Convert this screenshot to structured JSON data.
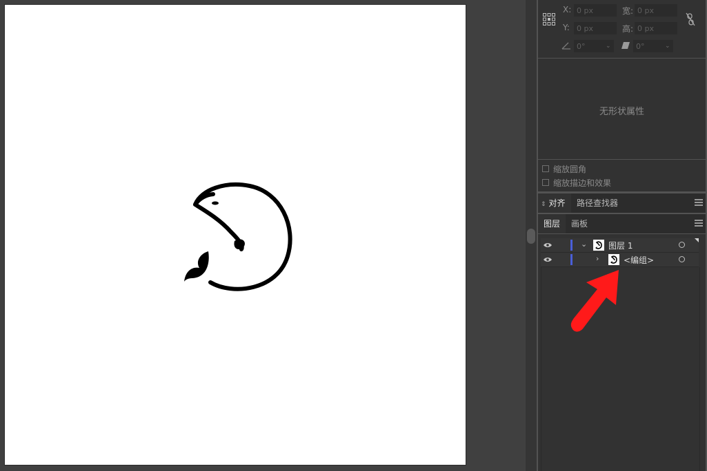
{
  "transform": {
    "reference_point_icon": "reference-point-grid-icon",
    "x_label": "X:",
    "x_value": "0 px",
    "y_label": "Y:",
    "y_value": "0 px",
    "width_label": "宽:",
    "width_value": "0 px",
    "height_label": "高:",
    "height_value": "0 px",
    "angle_value": "0°",
    "shear_value": "0°",
    "constrain_icon": "link-icon"
  },
  "shape": {
    "no_shape_text": "无形状属性"
  },
  "options": {
    "scale_corners": "缩放圆角",
    "scale_strokes": "缩放描边和效果"
  },
  "align_panel": {
    "tab_align": "对齐",
    "tab_pathfinder": "路径查找器"
  },
  "layers_panel": {
    "tab_layers": "图层",
    "tab_artboards": "画板",
    "rows": [
      {
        "name": "图层 1"
      },
      {
        "name": "<编组>"
      }
    ]
  },
  "colors": {
    "accent_layer": "#4a5fd8",
    "arrow": "#ff1a1a"
  }
}
